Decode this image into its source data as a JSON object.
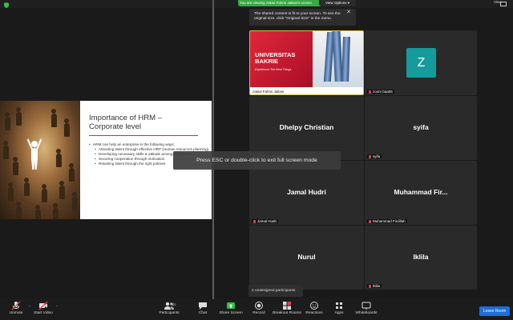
{
  "window": {
    "banner": "You are viewing zakiul Fahmi Jailani's screen",
    "view_options": "View Options ▾",
    "view_button": "View"
  },
  "tooltip": {
    "text": "The shared content is fit to your screen. To see the original size, click \"Original Size\" in the menu."
  },
  "overlay": {
    "esc_message": "Press ESC or double-click to exit full screen mode"
  },
  "slide": {
    "title": "Importance of HRM – Corporate level",
    "intro": "HRM can help an enterprise in the following ways:",
    "bullets": [
      "Attracting talent through effective HRP (Human resources planning)",
      "Developing necessary skills & attitude among employees",
      "Securing cooperation through motivation",
      "Retaining talent through the right policies"
    ]
  },
  "gallery": {
    "university": {
      "title_line1": "UNIVERSITAS",
      "title_line2": "BAKRIE",
      "tagline": "Experience The Real Things",
      "label": "zakiul Fahmi Jailani"
    },
    "zoom_tile": {
      "initial": "Z",
      "label": "zoom baa06"
    },
    "tiles": [
      {
        "name": "Dhelpy Christian",
        "label": "Dhelpy Christian"
      },
      {
        "name": "syifa",
        "label": "syifa"
      },
      {
        "name": "Jamal Hudri",
        "label": "Jamal Hudri"
      },
      {
        "name": "Muhammad  Fir...",
        "label": "Muhammad Firdillah"
      },
      {
        "name": "Nurul",
        "label": ""
      },
      {
        "name": "Iklila",
        "label": "Iklila"
      }
    ],
    "unassigned": "2 unassigned participants"
  },
  "toolbar": {
    "unmute": "Unmute",
    "start_video": "Start Video",
    "participants": "Participants",
    "participants_count": "22",
    "chat": "Chat",
    "share_screen": "Share Screen",
    "record": "Record",
    "breakout_rooms": "Breakout Rooms",
    "reactions": "Reactions",
    "apps": "Apps",
    "whiteboards": "Whiteboards",
    "leave_room": "Leave Room"
  },
  "colors": {
    "share_green": "#3aa845",
    "avatar_teal": "#159b9b",
    "leave_blue": "#1e6fd9",
    "active_speaker": "#d1c32a"
  }
}
